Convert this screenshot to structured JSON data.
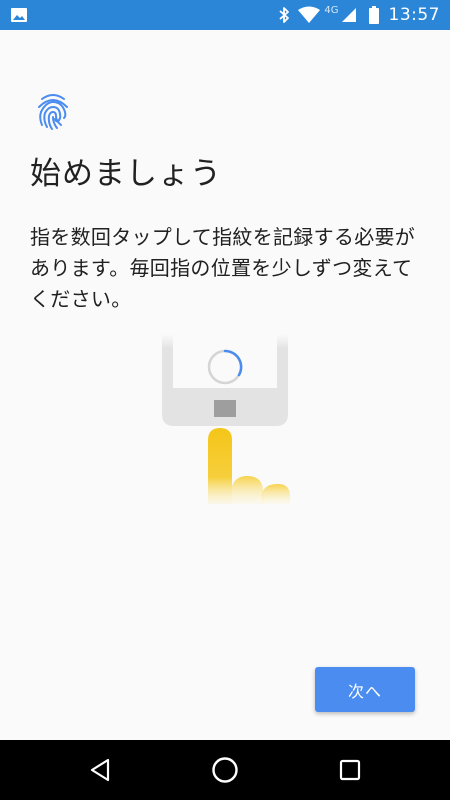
{
  "status_bar": {
    "time": "13:57",
    "network_type": "4G",
    "icons": [
      "image-icon",
      "bluetooth-icon",
      "wifi-icon",
      "signal-icon",
      "battery-icon"
    ],
    "background": "#2c86d8"
  },
  "content": {
    "icon": "fingerprint-icon",
    "title": "始めましょう",
    "description": "指を数回タップして指紋を記録する必要があります。毎回指の位置を少しずつ変えてください。",
    "illustration": "finger-tapping-phone-sensor",
    "accent_color": "#4a8cf0",
    "finger_color": "#f5c518"
  },
  "actions": {
    "next_label": "次へ"
  },
  "nav_bar": {
    "buttons": [
      "back-icon",
      "home-icon",
      "recents-icon"
    ]
  }
}
